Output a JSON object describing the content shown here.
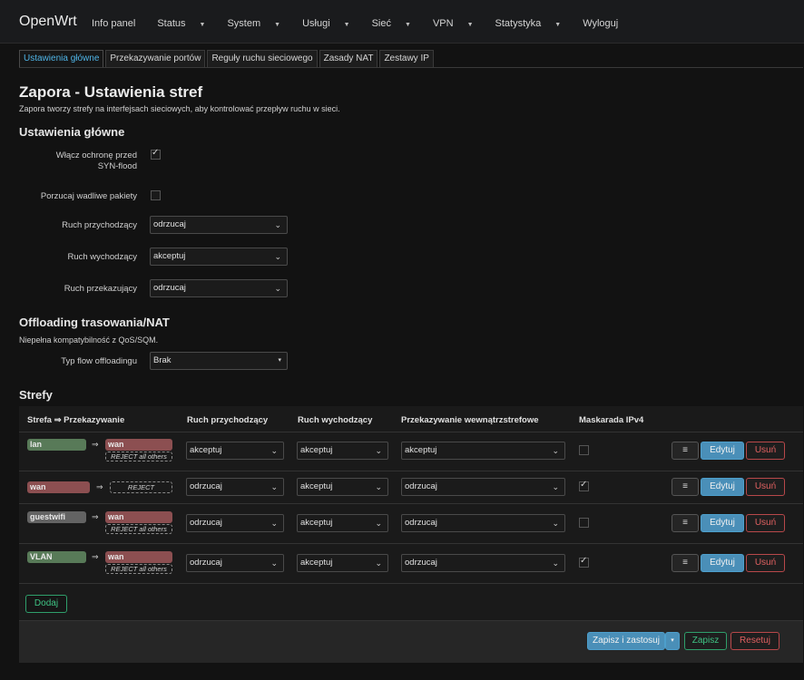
{
  "nav": {
    "brand": "OpenWrt",
    "items": [
      {
        "label": "Info panel",
        "dropdown": false
      },
      {
        "label": "Status",
        "dropdown": true
      },
      {
        "label": "System",
        "dropdown": true
      },
      {
        "label": "Usługi",
        "dropdown": true
      },
      {
        "label": "Sieć",
        "dropdown": true
      },
      {
        "label": "VPN",
        "dropdown": true
      },
      {
        "label": "Statystyka",
        "dropdown": true
      },
      {
        "label": "Wyloguj",
        "dropdown": false
      }
    ]
  },
  "tabs": [
    "Ustawienia główne",
    "Przekazywanie portów",
    "Reguły ruchu sieciowego",
    "Zasady NAT",
    "Zestawy IP"
  ],
  "page": {
    "title": "Zapora - Ustawienia stref",
    "description": "Zapora tworzy strefy na interfejsach sieciowych, aby kontrolować przepływ ruchu w sieci."
  },
  "general": {
    "heading": "Ustawienia główne",
    "synflood_label_line1": "Włącz ochronę przed",
    "synflood_label_line2": "SYN-flood",
    "synflood_checked": true,
    "drop_invalid_label": "Porzucaj wadliwe pakiety",
    "drop_invalid_checked": false,
    "input_label": "Ruch przychodzący",
    "input_value": "odrzucaj",
    "output_label": "Ruch wychodzący",
    "output_value": "akceptuj",
    "forward_label": "Ruch przekazujący",
    "forward_value": "odrzucaj"
  },
  "offloading": {
    "heading": "Offloading trasowania/NAT",
    "note": "Niepełna kompatybilność z QoS/SQM.",
    "type_label": "Typ flow offloadingu",
    "type_value": "Brak"
  },
  "zones": {
    "heading": "Strefy",
    "headers": {
      "zone": "Strefa ⇒ Przekazywanie",
      "input": "Ruch przychodzący",
      "output": "Ruch wychodzący",
      "intra": "Przekazywanie wewnątrzstrefowe",
      "masq": "Maskarada IPv4"
    },
    "arrow": "⇒",
    "edit_label": "Edytuj",
    "delete_label": "Usuń",
    "menu_glyph": "≡",
    "rows": [
      {
        "name": "lan",
        "color": "green",
        "dest": "wan",
        "dest_note": "REJECT all others",
        "input": "akceptuj",
        "output": "akceptuj",
        "intra": "akceptuj",
        "masq": false
      },
      {
        "name": "wan",
        "color": "red",
        "dest": "",
        "dest_note": "REJECT",
        "input": "odrzucaj",
        "output": "akceptuj",
        "intra": "odrzucaj",
        "masq": true
      },
      {
        "name": "guestwifi",
        "color": "gray",
        "dest": "wan",
        "dest_note": "REJECT all others",
        "input": "odrzucaj",
        "output": "akceptuj",
        "intra": "odrzucaj",
        "masq": false
      },
      {
        "name": "VLAN",
        "color": "green",
        "dest": "wan",
        "dest_note": "REJECT all others",
        "input": "odrzucaj",
        "output": "akceptuj",
        "intra": "odrzucaj",
        "masq": true
      }
    ],
    "add_label": "Dodaj"
  },
  "footer": {
    "save_apply": "Zapisz i zastosuj",
    "save": "Zapisz",
    "reset": "Resetuj"
  },
  "colors": {
    "accent": "#4a8fb8",
    "zone_green": "#587a58",
    "zone_red": "#8c4f51",
    "zone_gray": "#636363",
    "success": "#3fc384",
    "danger": "#e06060"
  }
}
